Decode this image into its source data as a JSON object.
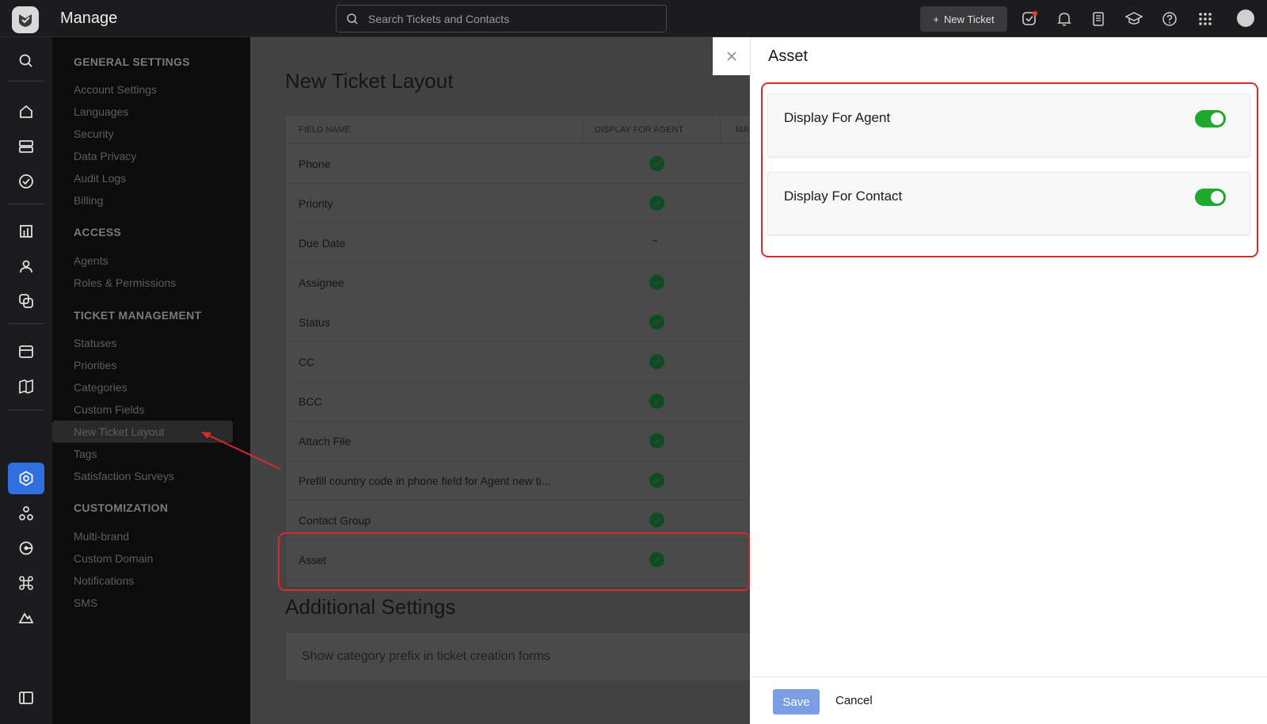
{
  "app": {
    "title": "Manage"
  },
  "header": {
    "search_placeholder": "Search Tickets and Contacts",
    "new_ticket_label": "New Ticket"
  },
  "sidebar": {
    "sections": [
      {
        "heading": "GENERAL SETTINGS",
        "items": [
          "Account Settings",
          "Languages",
          "Security",
          "Data Privacy",
          "Audit Logs",
          "Billing"
        ]
      },
      {
        "heading": "ACCESS",
        "items": [
          "Agents",
          "Roles & Permissions"
        ]
      },
      {
        "heading": "TICKET MANAGEMENT",
        "items": [
          "Statuses",
          "Priorities",
          "Categories",
          "Custom Fields",
          "New Ticket Layout",
          "Tags",
          "Satisfaction Surveys"
        ]
      },
      {
        "heading": "CUSTOMIZATION",
        "items": [
          "Multi-brand",
          "Custom Domain",
          "Notifications",
          "SMS"
        ]
      }
    ],
    "active_item": "New Ticket Layout"
  },
  "main": {
    "title": "New Ticket Layout",
    "columns": [
      "FIELD NAME",
      "DISPLAY FOR AGENT",
      "MA"
    ],
    "rows": [
      {
        "name": "Phone",
        "display_for_agent": "check"
      },
      {
        "name": "Priority",
        "display_for_agent": "check"
      },
      {
        "name": "Due Date",
        "display_for_agent": "~"
      },
      {
        "name": "Assignee",
        "display_for_agent": "check"
      },
      {
        "name": "Status",
        "display_for_agent": "check"
      },
      {
        "name": "CC",
        "display_for_agent": "check"
      },
      {
        "name": "BCC",
        "display_for_agent": "check"
      },
      {
        "name": "Attach File",
        "display_for_agent": "check"
      },
      {
        "name": "Prefill country code in phone field for Agent new ti...",
        "display_for_agent": "check"
      },
      {
        "name": "Contact Group",
        "display_for_agent": "check"
      },
      {
        "name": "Asset",
        "display_for_agent": "check"
      }
    ],
    "additional_title": "Additional Settings",
    "additional_item": "Show category prefix in ticket creation forms"
  },
  "drawer": {
    "title": "Asset",
    "toggles": [
      {
        "label": "Display For Agent",
        "on": true
      },
      {
        "label": "Display For Contact",
        "on": true
      }
    ],
    "save_label": "Save",
    "cancel_label": "Cancel"
  },
  "colors": {
    "accent": "#2f6fe0",
    "toggle_on": "#1faa2e",
    "highlight": "#d92a2a",
    "check": "#0e4d22"
  }
}
